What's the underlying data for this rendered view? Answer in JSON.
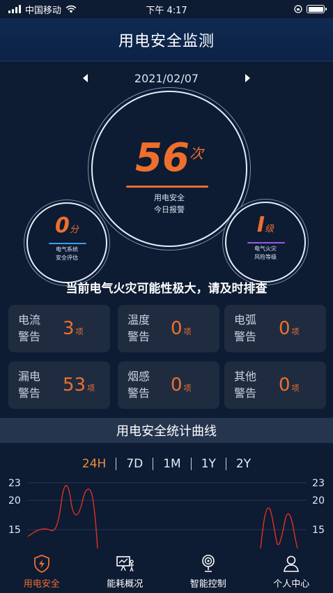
{
  "status": {
    "carrier": "中国移动",
    "time": "下午 4:17"
  },
  "header": {
    "title": "用电安全监测"
  },
  "date": {
    "value": "2021/02/07"
  },
  "main_stat": {
    "value": "56",
    "unit": "次",
    "line1": "用电安全",
    "line2": "今日报警"
  },
  "left_stat": {
    "value": "0",
    "unit": "分",
    "line1": "电气系统",
    "line2": "安全评估"
  },
  "right_stat": {
    "value": "Ⅰ",
    "unit": "级",
    "line1": "电气火灾",
    "line2": "风险等级"
  },
  "warning": "当前电气火灾可能性极大，请及时排查",
  "cards": [
    {
      "label1": "电流",
      "label2": "警告",
      "count": "3",
      "unit": "项"
    },
    {
      "label1": "温度",
      "label2": "警告",
      "count": "0",
      "unit": "项"
    },
    {
      "label1": "电弧",
      "label2": "警告",
      "count": "0",
      "unit": "项"
    },
    {
      "label1": "漏电",
      "label2": "警告",
      "count": "53",
      "unit": "项"
    },
    {
      "label1": "烟感",
      "label2": "警告",
      "count": "0",
      "unit": "项"
    },
    {
      "label1": "其他",
      "label2": "警告",
      "count": "0",
      "unit": "项"
    }
  ],
  "stats": {
    "title": "用电安全统计曲线",
    "ranges": [
      "24H",
      "7D",
      "1M",
      "1Y",
      "2Y"
    ],
    "active_range": "24H"
  },
  "chart_data": {
    "type": "line",
    "y_ticks": [
      23,
      20,
      15
    ],
    "ylim": [
      13,
      23
    ],
    "grid": true,
    "color": "#e0331f"
  },
  "tabs": [
    {
      "label": "用电安全",
      "icon": "shield-bolt-icon",
      "active": true
    },
    {
      "label": "能耗概况",
      "icon": "presentation-chart-icon",
      "active": false
    },
    {
      "label": "智能控制",
      "icon": "smart-control-icon",
      "active": false
    },
    {
      "label": "个人中心",
      "icon": "user-icon",
      "active": false
    }
  ],
  "colors": {
    "accent": "#ee6f2d",
    "bg": "#0d1b33",
    "card": "#1f2c40"
  }
}
